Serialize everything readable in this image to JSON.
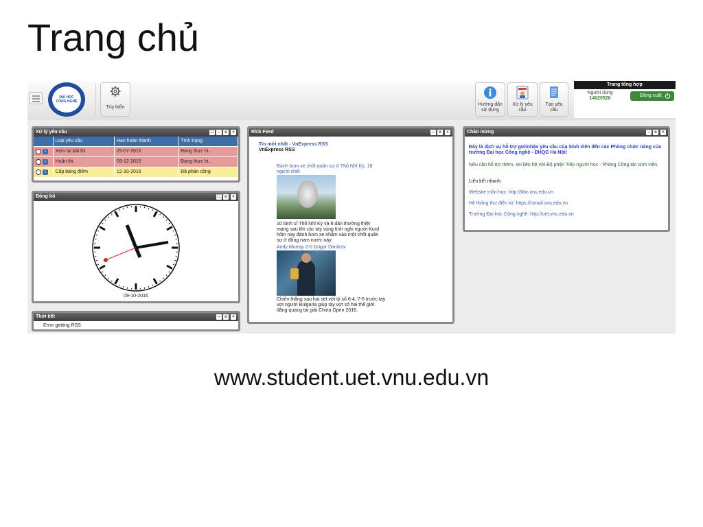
{
  "slide": {
    "title": "Trang chủ",
    "url": "www.student.uet.vnu.edu.vn"
  },
  "app": {
    "toolbar": {
      "customize_label": "Tùy biến",
      "guide_label_1": "Hướng dẫn",
      "guide_label_2": "sử dụng",
      "process_label_1": "Xử lý yêu",
      "process_label_2": "cầu",
      "create_label_1": "Tạo yêu",
      "create_label_2": "cầu"
    },
    "user": {
      "header": "Trang tổng hợp",
      "user_label": "Người dùng",
      "user_id": "14020520",
      "logout_label": "Đăng xuất"
    },
    "requests": {
      "title": "Xử lý yêu cầu",
      "columns": [
        "Loại yêu cầu",
        "Hạn hoàn thành",
        "Tình trạng"
      ],
      "rows": [
        {
          "type": "Xem lại bài thi",
          "deadline": "25-07-2015",
          "status": "Đang thực hi..."
        },
        {
          "type": "Hoãn thi",
          "deadline": "09-12-2015",
          "status": "Đang thực hi..."
        },
        {
          "type": "Cấp bảng điểm",
          "deadline": "12-10-2016",
          "status": "Đã phản cồng"
        }
      ]
    },
    "clock": {
      "title": "Đồng hồ",
      "date": "09-10-2016"
    },
    "weather": {
      "title": "Thời tiết",
      "message": "Error getting RSS"
    },
    "rss": {
      "title": "RSS Feed",
      "heading": "Tin mới nhất - VnExpress RSS",
      "source": "VnExpress RSS",
      "item1_title": "Đánh bom xe chốt quân sự ở Thổ Nhĩ Kỳ, 18 người chết",
      "item1_desc": "10 binh sĩ Thổ Nhĩ Kỳ và 8 dân thường thiệt mạng sau khi các tay súng tình nghi người Kurd hôm nay đánh bom xe nhằm vào một chốt quân sự ở đông nam nước này.",
      "item2_title": "Andy Murray 2-0 Grigor Dimitrov",
      "item2_desc": "Chiến thắng sau hai set với tỷ số 6-4, 7-6 trước tay vợt người Bulgaria giúp tay vợt số hai thế giới đăng quang tại giải China Open 2016."
    },
    "welcome": {
      "title": "Chào mừng",
      "intro": "Đây là dịch vụ hỗ trợ gửi/nhận yêu cầu của Sinh viên đến các Phòng chức năng của trường Đại học Công nghệ - ĐHQG Hà Nội!",
      "support": "Nếu cần hỗ trợ thêm, xin liên hệ với Bộ phận Tiếp người học - Phòng Công tác sinh viên.",
      "quick_links_label": "Liên kết nhanh:",
      "link1": "Website môn học: http://bbc.vnu.edu.vn",
      "link2": "Hệ thống thư điện tử: https://ctmail.vnu.edu.vn",
      "link3": "Trường Đại học Công nghệ: http://uet.vnu.edu.vn"
    },
    "colors": {
      "header_dark": "#3e3e3e",
      "table_header": "#3d6ea8",
      "row_overdue": "#e69b9b",
      "row_done": "#f8ef98",
      "accent_green": "#3a8a3a",
      "welcome_blue": "#2a3fc0"
    }
  }
}
